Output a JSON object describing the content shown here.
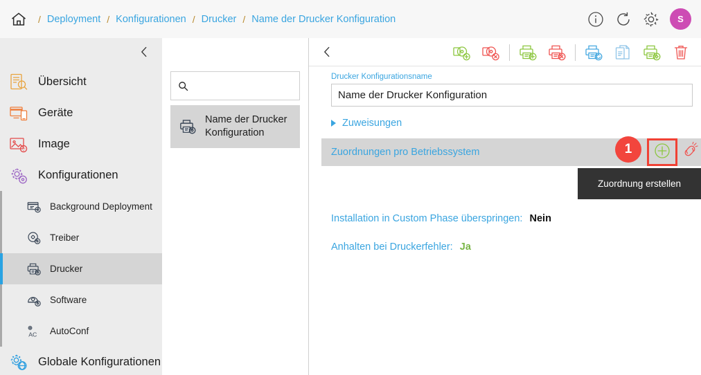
{
  "breadcrumb": {
    "home_icon": "home-icon",
    "separator": "/",
    "items": [
      {
        "label": "Deployment"
      },
      {
        "label": "Konfigurationen"
      },
      {
        "label": "Drucker"
      },
      {
        "label": "Name der Drucker Konfiguration"
      }
    ]
  },
  "topbar": {
    "info_icon": "info-icon",
    "refresh_icon": "refresh-icon",
    "settings_icon": "gear-icon",
    "avatar_initial": "S",
    "avatar_color": "#cd4cb4"
  },
  "sidebar": {
    "collapse_icon": "chevron-left-icon",
    "items": [
      {
        "label": "Übersicht",
        "icon": "overview-icon",
        "color": "#e8a33d",
        "level": 0,
        "active": false
      },
      {
        "label": "Geräte",
        "icon": "devices-icon",
        "color": "#ef7d3a",
        "level": 0,
        "active": false
      },
      {
        "label": "Image",
        "icon": "image-icon",
        "color": "#e34a4a",
        "level": 0,
        "active": false
      },
      {
        "label": "Konfigurationen",
        "icon": "config-icon",
        "color": "#9b64c4",
        "level": 0,
        "active": false
      },
      {
        "label": "Background Deployment",
        "icon": "background-deployment-icon",
        "color": "#3c4858",
        "level": 1,
        "active": false
      },
      {
        "label": "Treiber",
        "icon": "driver-icon",
        "color": "#3c4858",
        "level": 1,
        "active": false
      },
      {
        "label": "Drucker",
        "icon": "printer-icon",
        "color": "#3c4858",
        "level": 1,
        "active": true
      },
      {
        "label": "Software",
        "icon": "software-icon",
        "color": "#3c4858",
        "level": 1,
        "active": false
      },
      {
        "label": "AutoConf",
        "icon": "autoconf-icon",
        "color": "#3c4858",
        "level": 1,
        "active": false
      },
      {
        "label": "Globale Konfigurationen",
        "icon": "global-config-icon",
        "color": "#2f9fe0",
        "level": 0,
        "active": false
      }
    ]
  },
  "list_panel": {
    "search": {
      "placeholder": "",
      "value": "",
      "icon": "search-icon"
    },
    "items": [
      {
        "label": "Name der Drucker Konfiguration",
        "icon": "printer-config-icon",
        "selected": true
      }
    ]
  },
  "content": {
    "back_icon": "chevron-left-icon",
    "toolbar_buttons": [
      {
        "name": "add-driver-package-button",
        "icon": "printer-disc-plus-icon",
        "color": "#8cc63f"
      },
      {
        "name": "delete-driver-package-button",
        "icon": "printer-disc-delete-icon",
        "color": "#ef5350"
      },
      {
        "name": "add-printer-button",
        "icon": "printer-plus-icon",
        "color": "#8cc63f"
      },
      {
        "name": "delete-printer-button",
        "icon": "printer-delete-icon",
        "color": "#ef5350"
      },
      {
        "name": "sync-printer-button",
        "icon": "printer-sync-icon",
        "color": "#45a8e0"
      },
      {
        "name": "copy-document-button",
        "icon": "copy-document-icon",
        "color": "#8ec4e8"
      },
      {
        "name": "printer-settings-button",
        "icon": "printer-gear-icon",
        "color": "#8cc63f"
      },
      {
        "name": "delete-button",
        "icon": "trash-icon",
        "color": "#ef5350"
      }
    ],
    "name_field": {
      "label": "Drucker Konfigurationsname",
      "value": "Name der Drucker Konfiguration",
      "placeholder": ""
    },
    "expander": {
      "label": "Zuweisungen",
      "expanded": false
    },
    "section": {
      "title": "Zuordnungen pro Betriebssystem",
      "add_icon": "plus-circle-icon",
      "unlink_icon": "unlink-icon",
      "step_badge": "1",
      "highlight_color": "#f04134"
    },
    "tooltip": {
      "text": "Zuordnung erstellen"
    },
    "rows": [
      {
        "label": "Installation in Custom Phase überspringen:",
        "value": "Nein",
        "value_style": "dark"
      },
      {
        "label": "Anhalten bei Druckerfehler:",
        "value": "Ja",
        "value_style": "green"
      }
    ]
  }
}
